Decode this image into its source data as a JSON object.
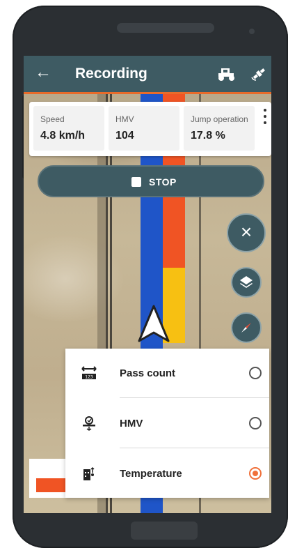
{
  "app": {
    "title": "Recording",
    "back_icon": "back-arrow-icon",
    "action_icons": [
      "roller-vehicle-icon",
      "satellite-icon"
    ],
    "accent_color": "#e96b2a",
    "bar_color": "#3e5b63"
  },
  "stats": [
    {
      "label": "Speed",
      "value": "4.8 km/h"
    },
    {
      "label": "HMV",
      "value": "104"
    },
    {
      "label": "Jump operation",
      "value": "17.8 %"
    }
  ],
  "stop_button": {
    "label": "STOP"
  },
  "map_controls": [
    "close-icon",
    "layers-icon",
    "compass-icon"
  ],
  "layer_options": [
    {
      "label": "Pass count",
      "icon": "pass-count-icon",
      "selected": false
    },
    {
      "label": "HMV",
      "icon": "hmv-sensor-icon",
      "selected": false
    },
    {
      "label": "Temperature",
      "icon": "temperature-icon",
      "selected": true
    }
  ],
  "track_colors": {
    "blue": "#1f55c8",
    "orange": "#f05424",
    "yellow": "#f7c012"
  }
}
